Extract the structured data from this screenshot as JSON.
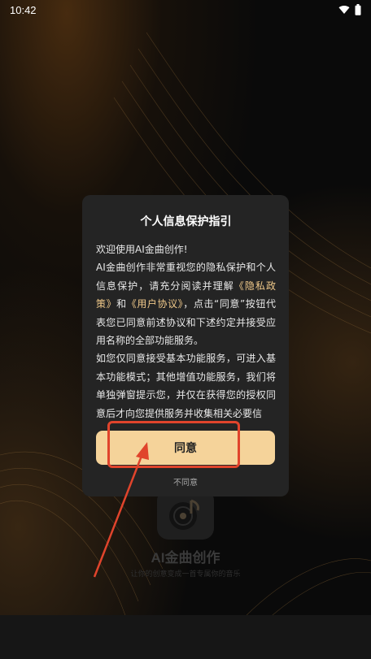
{
  "status_bar": {
    "time": "10:42"
  },
  "dialog": {
    "title": "个人信息保护指引",
    "greeting": "欢迎使用AI金曲创作!",
    "p1_part1": "AI金曲创作非常重视您的隐私保护和个人信息保护，请充分阅读并理解",
    "privacy_link": "《隐私政策》",
    "and": "和",
    "user_link": "《用户协议》",
    "p1_part2": "，点击“同意”按钮代表您已同意前述协议和下述约定并接受应用名称的全部功能服务。",
    "p2": "如您仅同意接受基本功能服务，可进入基本功能模式；其他增值功能服务，我们将单独弹窗提示您，并仅在获得您的授权同意后才向您提供服务并收集相关必要信",
    "agree_label": "同意",
    "disagree_label": "不同意"
  },
  "app": {
    "name": "AI金曲创作",
    "slogan": "让你的创意变成一首专属你的音乐"
  },
  "colors": {
    "accent": "#f5d39a",
    "link": "#f0c98a",
    "annotation": "#e0442c"
  }
}
